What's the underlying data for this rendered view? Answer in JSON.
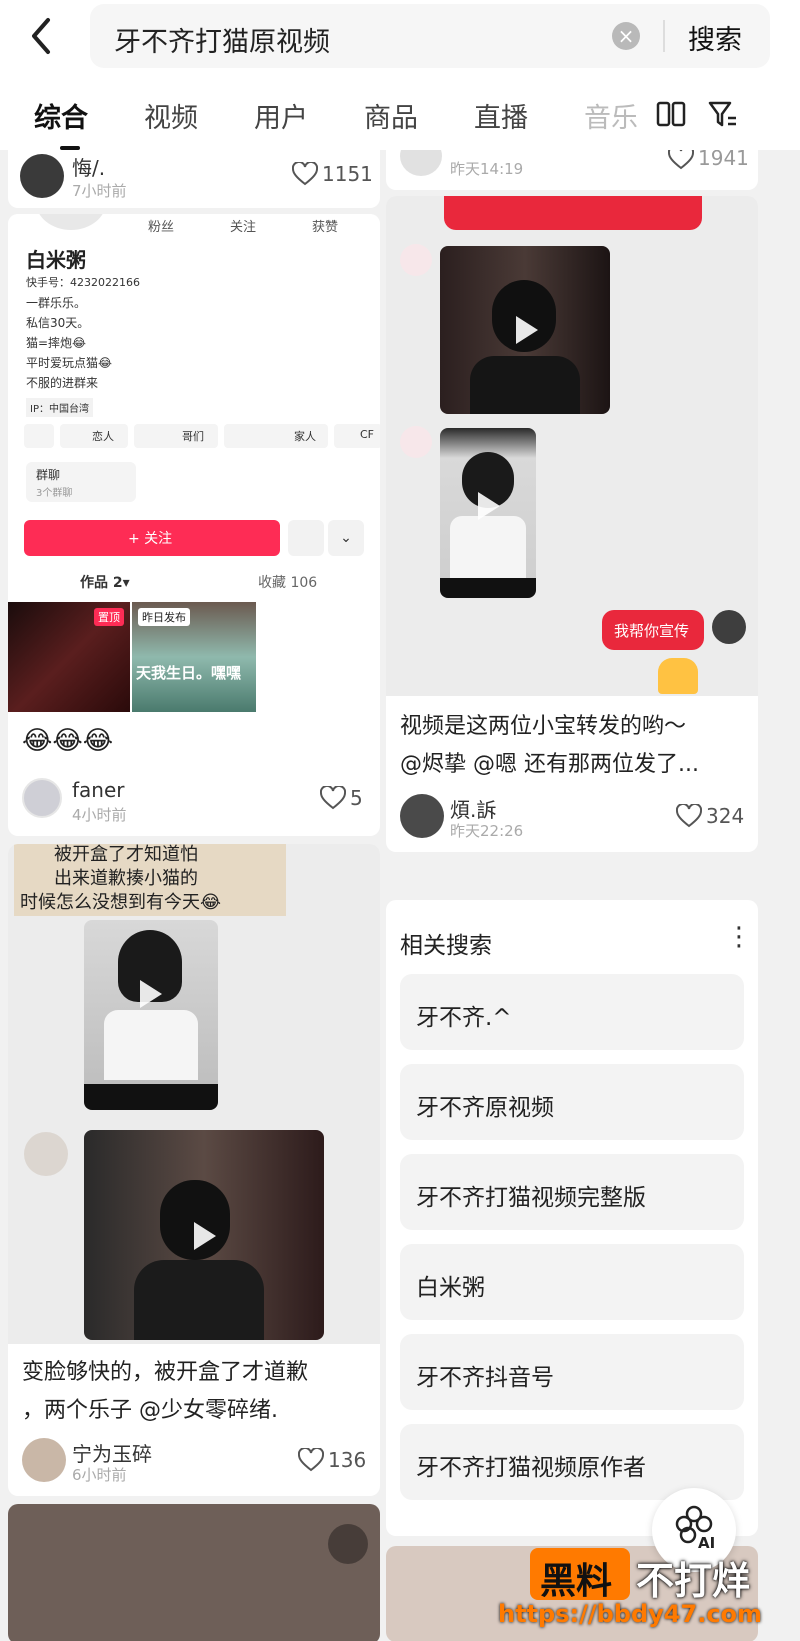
{
  "search": {
    "query": "牙不齐打猫原视频",
    "button": "搜索"
  },
  "tabs": [
    {
      "label": "综合"
    },
    {
      "label": "视频"
    },
    {
      "label": "用户"
    },
    {
      "label": "商品"
    },
    {
      "label": "直播"
    },
    {
      "label": "音乐"
    }
  ],
  "left": {
    "top_card": {
      "name": "悔/.",
      "time": "7小时前",
      "likes": "1151"
    },
    "profile_card": {
      "stats_labels": [
        "粉丝",
        "关注",
        "获赞"
      ],
      "nickname": "白米粥",
      "id_line": "快手号：4232022166",
      "bio": [
        "一群乐乐。",
        "私信30天。",
        "猫=摔炮😂",
        "平时爱玩点猫😂",
        "不服的进群来"
      ],
      "ip": "IP：中国台湾",
      "groups": [
        "恋人",
        "哥们",
        "家人",
        "CF"
      ],
      "group_chat_title": "群聊",
      "group_chat_count": "3个群聊",
      "follow_button": "+ 关注",
      "works_tab": "作品 2▾",
      "collect_tab": "收藏 106",
      "badge_pinned": "置顶",
      "badge_yesterday": "昨日发布",
      "thumb_caption": "天我生日。嘿嘿",
      "caption_emoji": "😂😂😂",
      "author": "faner",
      "time": "4小时前",
      "likes": "5"
    },
    "video_card": {
      "handwritten_line1": "被开盒了才知道怕",
      "handwritten_line2": "出来道歉揍小猫的",
      "handwritten_line3": "时候怎么没想到有今天😂",
      "title_line1": "变脸够快的，被开盒了才道歉",
      "title_line2": "，两个乐子 @少女零碎绪.",
      "author": "宁为玉碎",
      "time": "6小时前",
      "likes": "136"
    }
  },
  "right": {
    "top_card": {
      "time": "昨天14:19",
      "likes": "1941"
    },
    "chat_card": {
      "red_bubble_text": "我帮你宣传",
      "caption_line1": "视频是这两位小宝转发的哟～",
      "caption_line2": "@烬挚 @嗯  还有那两位发了...",
      "author": "煩.訴",
      "time": "昨天22:26",
      "likes": "324"
    },
    "related": {
      "title": "相关搜索",
      "items": [
        "牙不齐.^",
        "牙不齐原视频",
        "牙不齐打猫视频完整版",
        "白米粥",
        "牙不齐抖音号",
        "牙不齐打猫视频原作者"
      ]
    }
  },
  "watermark": {
    "brand": "黑料",
    "slogan": "不打烊",
    "url": "https://bbdy47.com",
    "ai_label": "AI"
  }
}
